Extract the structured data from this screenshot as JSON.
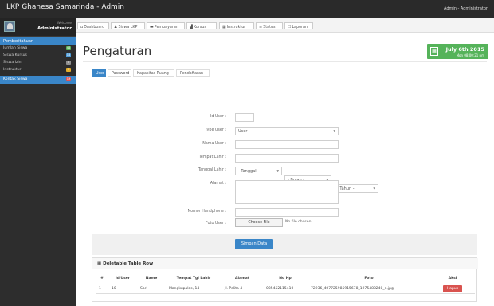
{
  "app": {
    "title": "LKP Ghanesa Samarinda - Admin",
    "user": "Admin - Administrator"
  },
  "sidebar": {
    "welcome": "Welcome",
    "admin_name": "Administrator",
    "section_title": "Pemberitahuan",
    "items": [
      {
        "label": "Jumlah Siswa",
        "badge": "46"
      },
      {
        "label": "Siswa Kursus",
        "badge": "18"
      },
      {
        "label": "Siswa Izin",
        "badge": "0"
      },
      {
        "label": "Instruktur",
        "badge": "1"
      },
      {
        "label": "Kontak Siswa",
        "badge": "19"
      }
    ]
  },
  "nav_tabs": [
    {
      "label": "Dashboard",
      "icon": "home-icon"
    },
    {
      "label": "Siswa LKP",
      "icon": "users-icon"
    },
    {
      "label": "Pembayaran",
      "icon": "cash-icon"
    },
    {
      "label": "Kursus",
      "icon": "chart-icon"
    },
    {
      "label": "Instruktur",
      "icon": "card-icon"
    },
    {
      "label": "Status",
      "icon": "list-icon"
    },
    {
      "label": "Laporan",
      "icon": "doc-icon"
    }
  ],
  "page": {
    "title": "Pengaturan",
    "date_main": "July 6th 2015",
    "date_sub": "Mon 08:00:21 pm"
  },
  "form_tabs": [
    {
      "label": "User"
    },
    {
      "label": "Password"
    },
    {
      "label": "Kapasitas Ruang"
    },
    {
      "label": "Pendaftaran"
    }
  ],
  "form": {
    "id_user": {
      "label": "Id User :",
      "value": ""
    },
    "type_user": {
      "label": "Type User :",
      "value": "User"
    },
    "nama_user": {
      "label": "Nama User :",
      "value": ""
    },
    "tempat_lahir": {
      "label": "Tempat Lahir :",
      "value": ""
    },
    "tanggal_lahir": {
      "label": "Tanggal Lahir :",
      "tanggal": "- Tanggal -",
      "bulan": "- Bulan -",
      "tahun": "- Tahun -"
    },
    "alamat": {
      "label": "Alamat :",
      "value": ""
    },
    "nomor_handphone": {
      "label": "Nomor Handphone :",
      "value": ""
    },
    "foto_user": {
      "label": "Foto User :",
      "button": "Choose File",
      "status": "No file chosen"
    },
    "save_button": "Simpan Data"
  },
  "table": {
    "title": "Deletable Table Row",
    "headers": [
      "#",
      "Id User",
      "Name",
      "Tempat Tgl Lahir",
      "Alamat",
      "No Hp",
      "Foto",
      "Aksi"
    ],
    "rows": [
      [
        "1",
        "10",
        "Sari",
        "Mangkupalas, 14",
        "Jl. Pelita 4",
        "085452115410",
        "72936_407725985915678_1975488240_n.jpg",
        "Hapus"
      ]
    ]
  }
}
